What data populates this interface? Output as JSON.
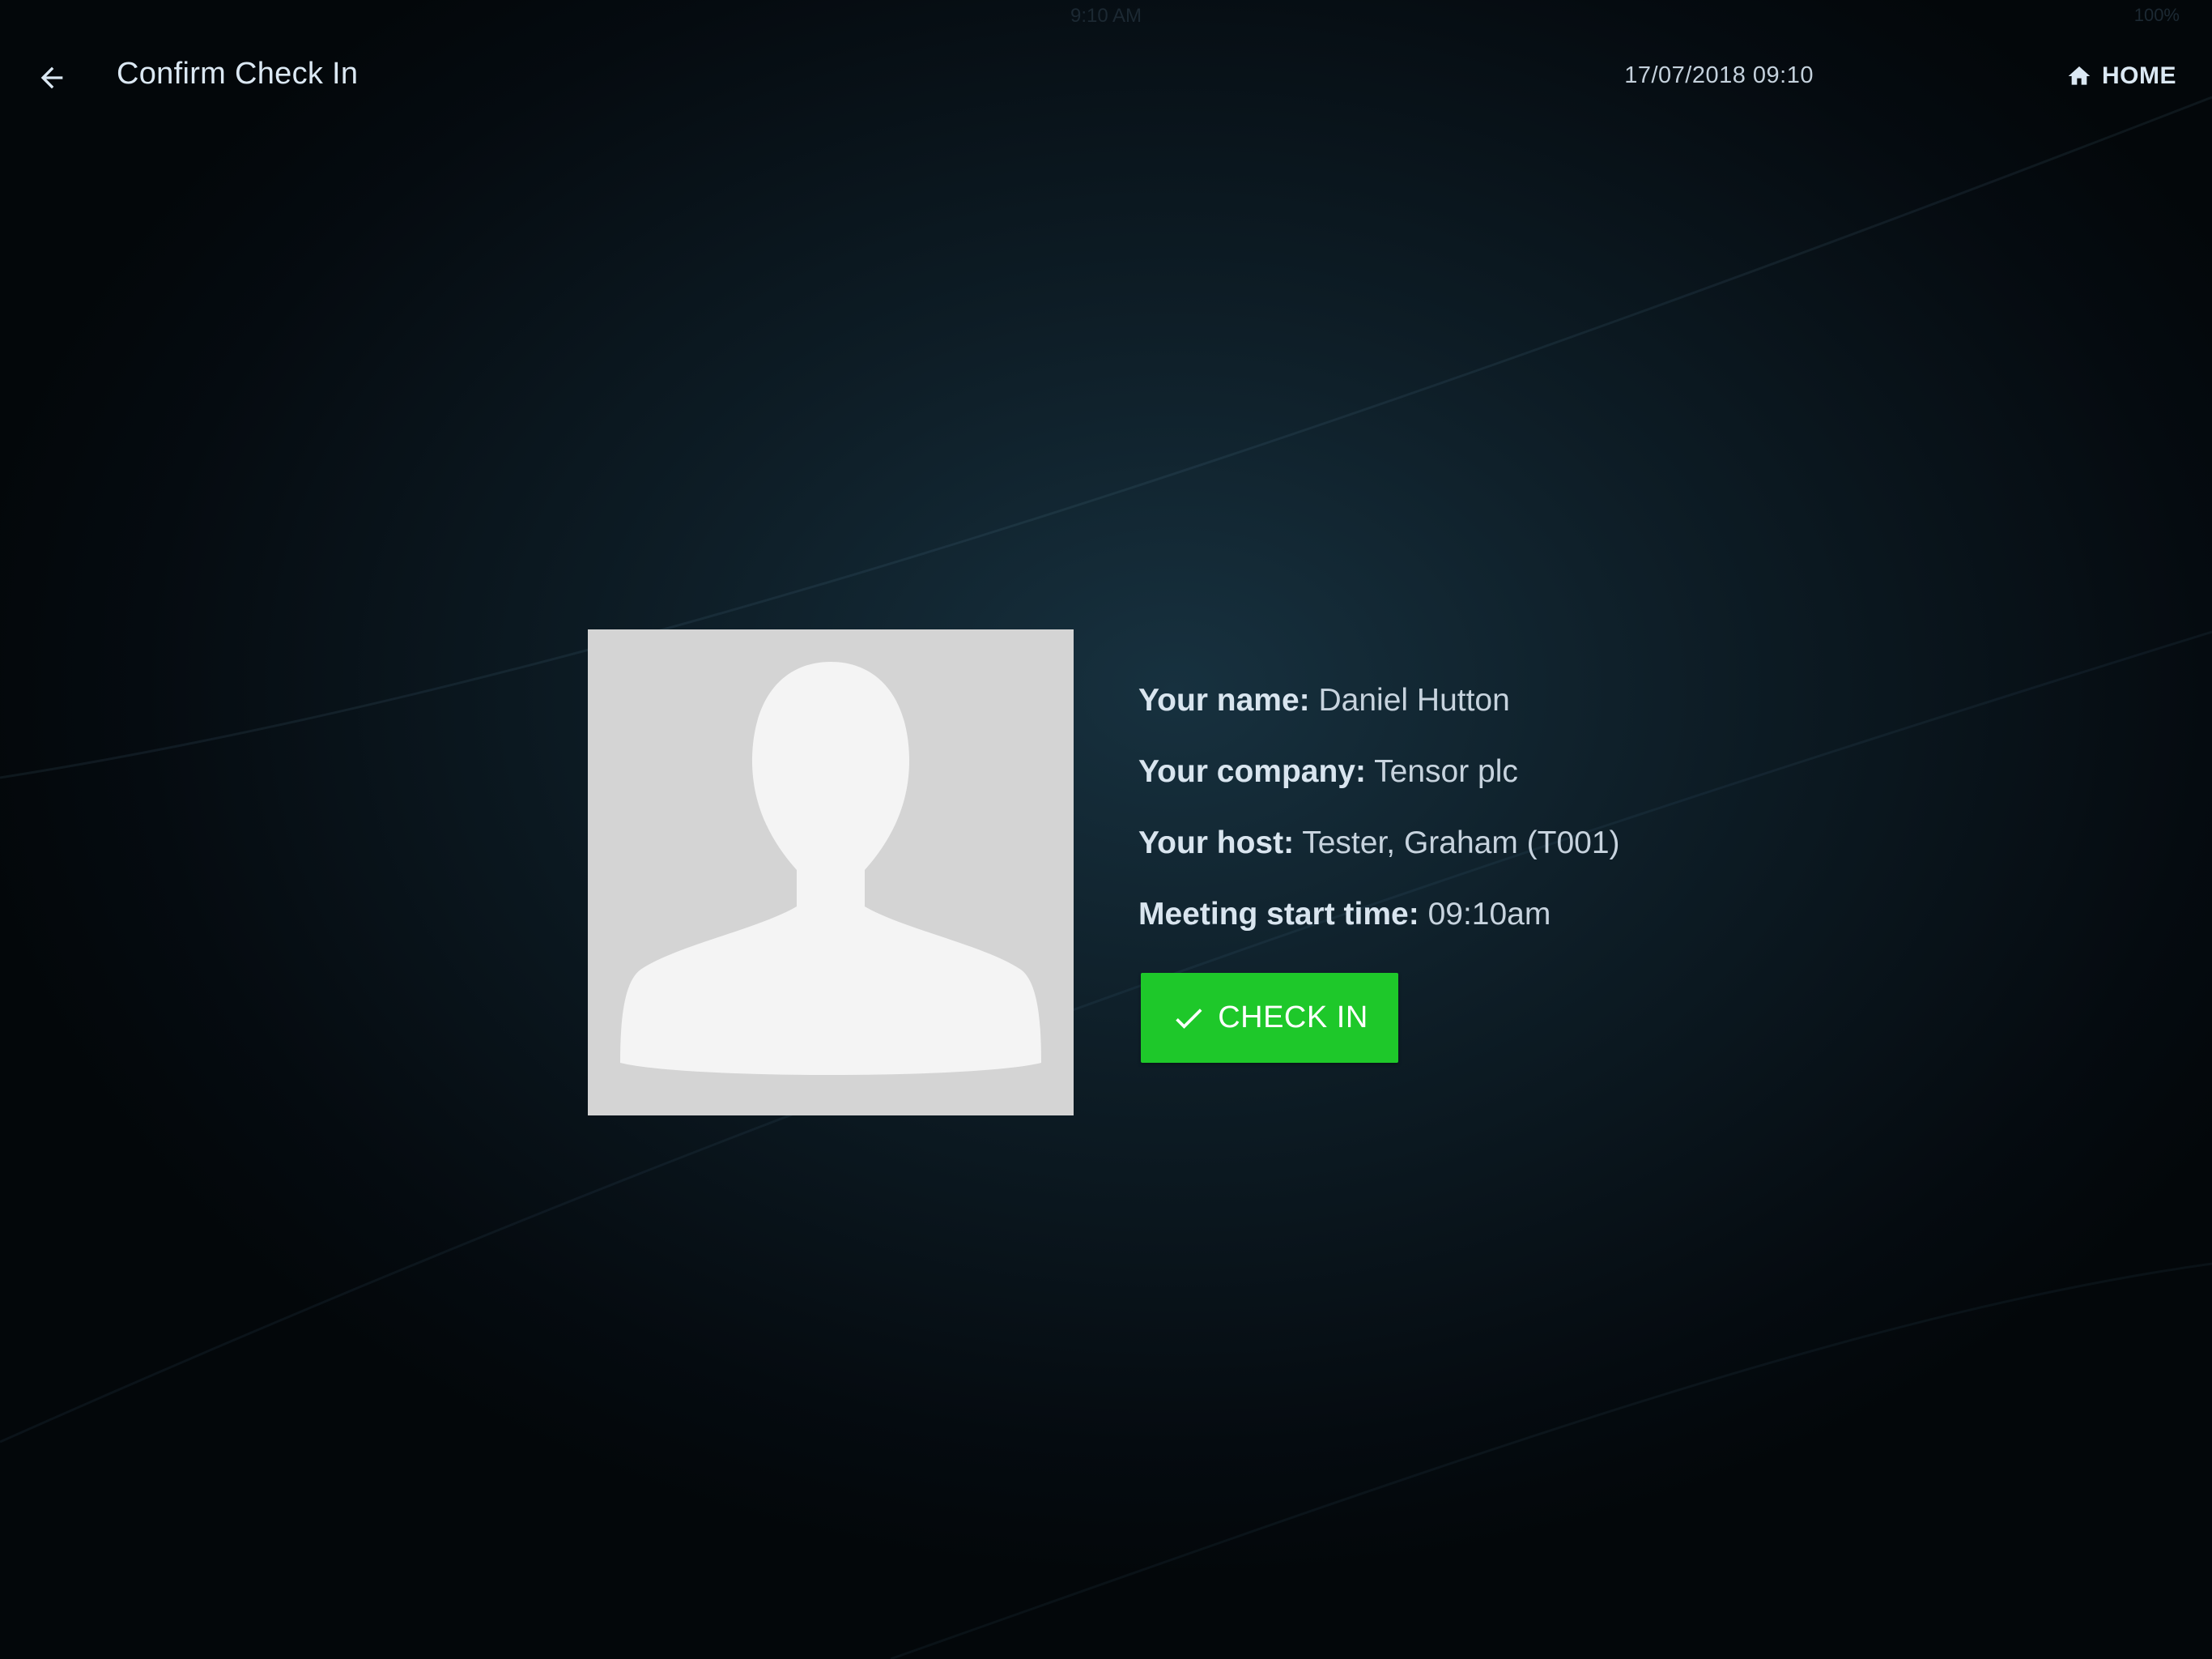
{
  "status_bar": {
    "time": "9:10 AM",
    "battery": "100%"
  },
  "header": {
    "back_icon": "arrow-left-icon",
    "title": "Confirm Check In",
    "datetime": "17/07/2018 09:10",
    "home_icon": "home-icon",
    "home_label": "HOME"
  },
  "visitor": {
    "photo_icon": "person-silhouette-icon",
    "name_label": "Your name:",
    "name_value": "Daniel Hutton",
    "company_label": "Your company:",
    "company_value": "Tensor plc",
    "host_label": "Your host:",
    "host_value": "Tester, Graham (T001)",
    "meeting_label": "Meeting start time:",
    "meeting_value": "09:10am"
  },
  "actions": {
    "checkin_icon": "checkmark-icon",
    "checkin_label": "CHECK IN"
  },
  "colors": {
    "accent_green": "#1ec82a",
    "text_light": "#dbe8f3",
    "avatar_bg": "#d4d4d4",
    "background_dark": "#050b10"
  }
}
